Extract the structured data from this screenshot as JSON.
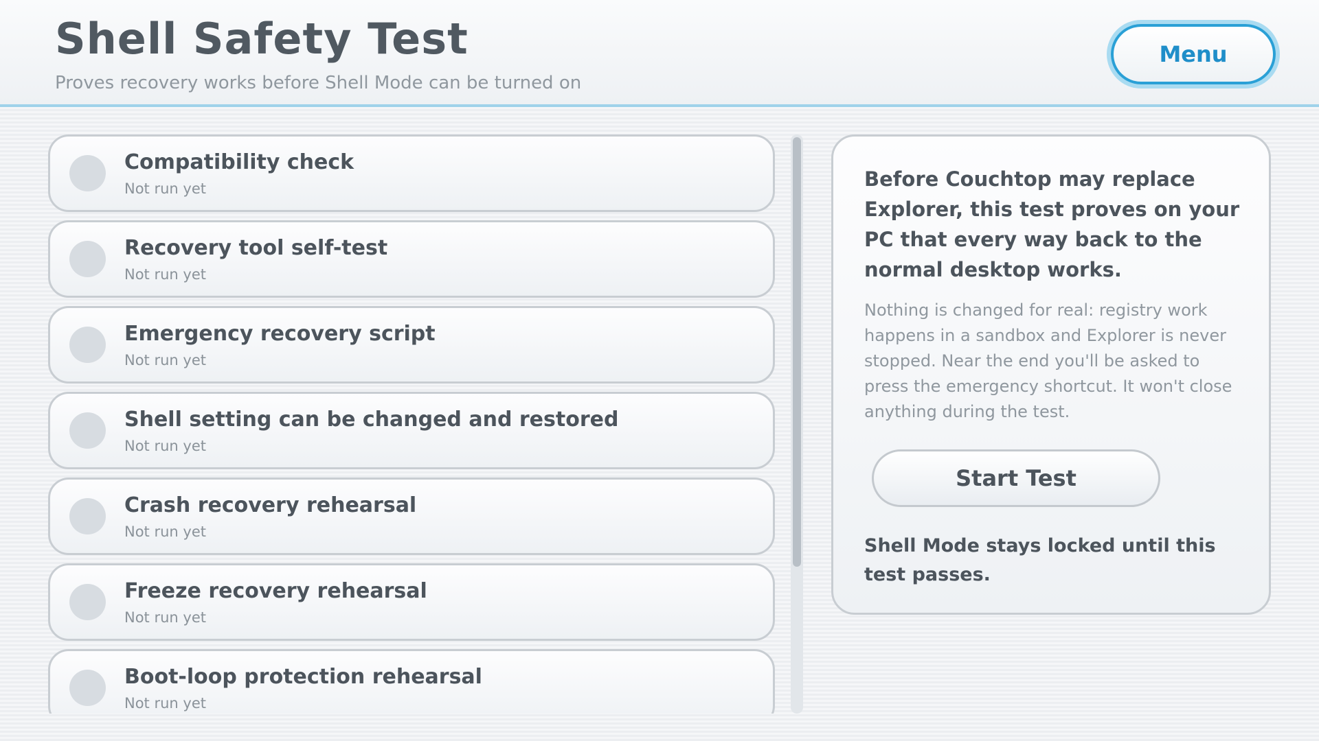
{
  "header": {
    "title": "Shell Safety Test",
    "subtitle": "Proves recovery works before Shell Mode can be turned on",
    "menu_label": "Menu"
  },
  "checks": [
    {
      "name": "Compatibility check",
      "status": "Not run yet"
    },
    {
      "name": "Recovery tool self-test",
      "status": "Not run yet"
    },
    {
      "name": "Emergency recovery script",
      "status": "Not run yet"
    },
    {
      "name": "Shell setting can be changed and restored",
      "status": "Not run yet"
    },
    {
      "name": "Crash recovery rehearsal",
      "status": "Not run yet"
    },
    {
      "name": "Freeze recovery rehearsal",
      "status": "Not run yet"
    },
    {
      "name": "Boot-loop protection rehearsal",
      "status": "Not run yet"
    }
  ],
  "panel": {
    "intro": "Before Couchtop may replace Explorer, this test proves on your PC that every way back to the normal desktop works.",
    "details": "Nothing is changed for real: registry work happens in a sandbox and Explorer is never stopped. Near the end you'll be asked to press the emergency shortcut. It won't close anything during the test.",
    "start_label": "Start Test",
    "lock_note": "Shell Mode stays locked until this test passes."
  },
  "colors": {
    "accent": "#2aa0d6",
    "accent_glow": "#a9dbf1",
    "text_primary": "#4c545c",
    "text_muted": "#8f979e",
    "status_pending": "#d7dce1"
  }
}
